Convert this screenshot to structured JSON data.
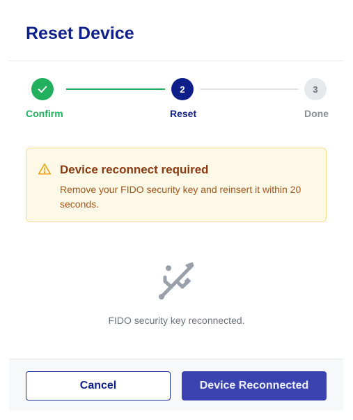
{
  "dialog": {
    "title": "Reset Device"
  },
  "stepper": {
    "steps": [
      {
        "number": "1",
        "label": "Confirm",
        "state": "complete"
      },
      {
        "number": "2",
        "label": "Reset",
        "state": "active"
      },
      {
        "number": "3",
        "label": "Done",
        "state": "pending"
      }
    ]
  },
  "alert": {
    "icon": "warning-triangle-icon",
    "title": "Device reconnect required",
    "message": "Remove your FIDO security key and reinsert it within 20 seconds."
  },
  "status": {
    "icon": "usb-icon",
    "text": "FIDO security key reconnected."
  },
  "footer": {
    "cancel_label": "Cancel",
    "primary_label": "Device Reconnected"
  },
  "colors": {
    "brand": "#0f1f8a",
    "success": "#22b05e",
    "warning_bg": "#fef9e7",
    "warning_text": "#8a3b12",
    "primary_button": "#3a43b0"
  }
}
